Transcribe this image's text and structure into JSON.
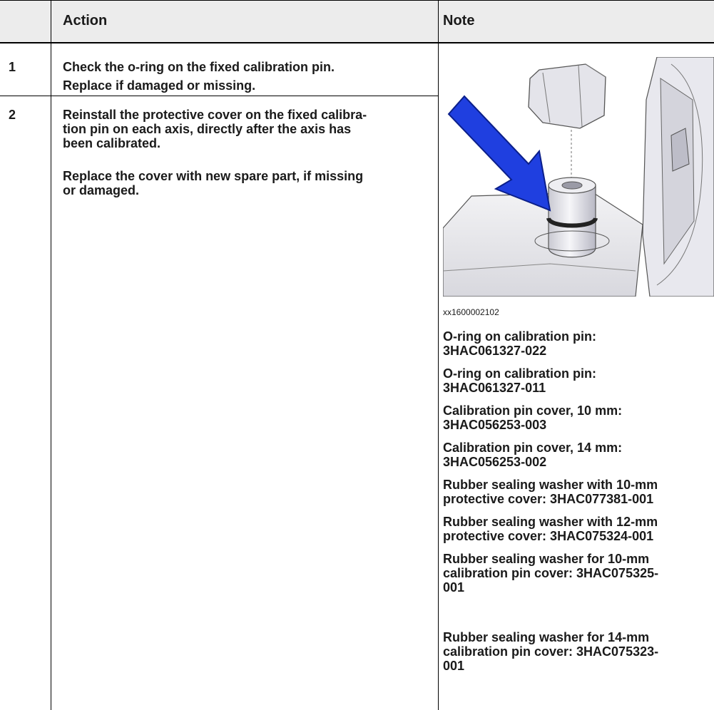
{
  "table": {
    "header": {
      "action": "Action",
      "note": "Note"
    },
    "rows": [
      {
        "num": "1",
        "action": [
          "Check the o-ring on the fixed calibration pin.",
          "Replace if damaged or missing."
        ]
      },
      {
        "num": "2",
        "action": [
          "Reinstall the protective cover on the fixed calibra-\ntion pin on each axis, directly after the axis has\nbeen calibrated.",
          "Replace the cover with new spare part, if missing\nor damaged."
        ]
      }
    ],
    "note": {
      "image_caption": "xx1600002102",
      "items": [
        "O-ring on calibration pin:\n3HAC061327-022",
        "O-ring on calibration pin:\n3HAC061327-011",
        "Calibration pin cover, 10 mm:\n3HAC056253-003",
        "Calibration pin cover, 14 mm:\n3HAC056253-002",
        "Rubber sealing washer with 10-mm\nprotective cover: 3HAC077381-001",
        "Rubber sealing washer with 12-mm\nprotective cover: 3HAC075324-001",
        "Rubber sealing washer for 10-mm\ncalibration pin cover: 3HAC075325-\n001",
        "Rubber sealing washer for 14-mm\ncalibration pin cover: 3HAC075323-\n001"
      ]
    }
  }
}
